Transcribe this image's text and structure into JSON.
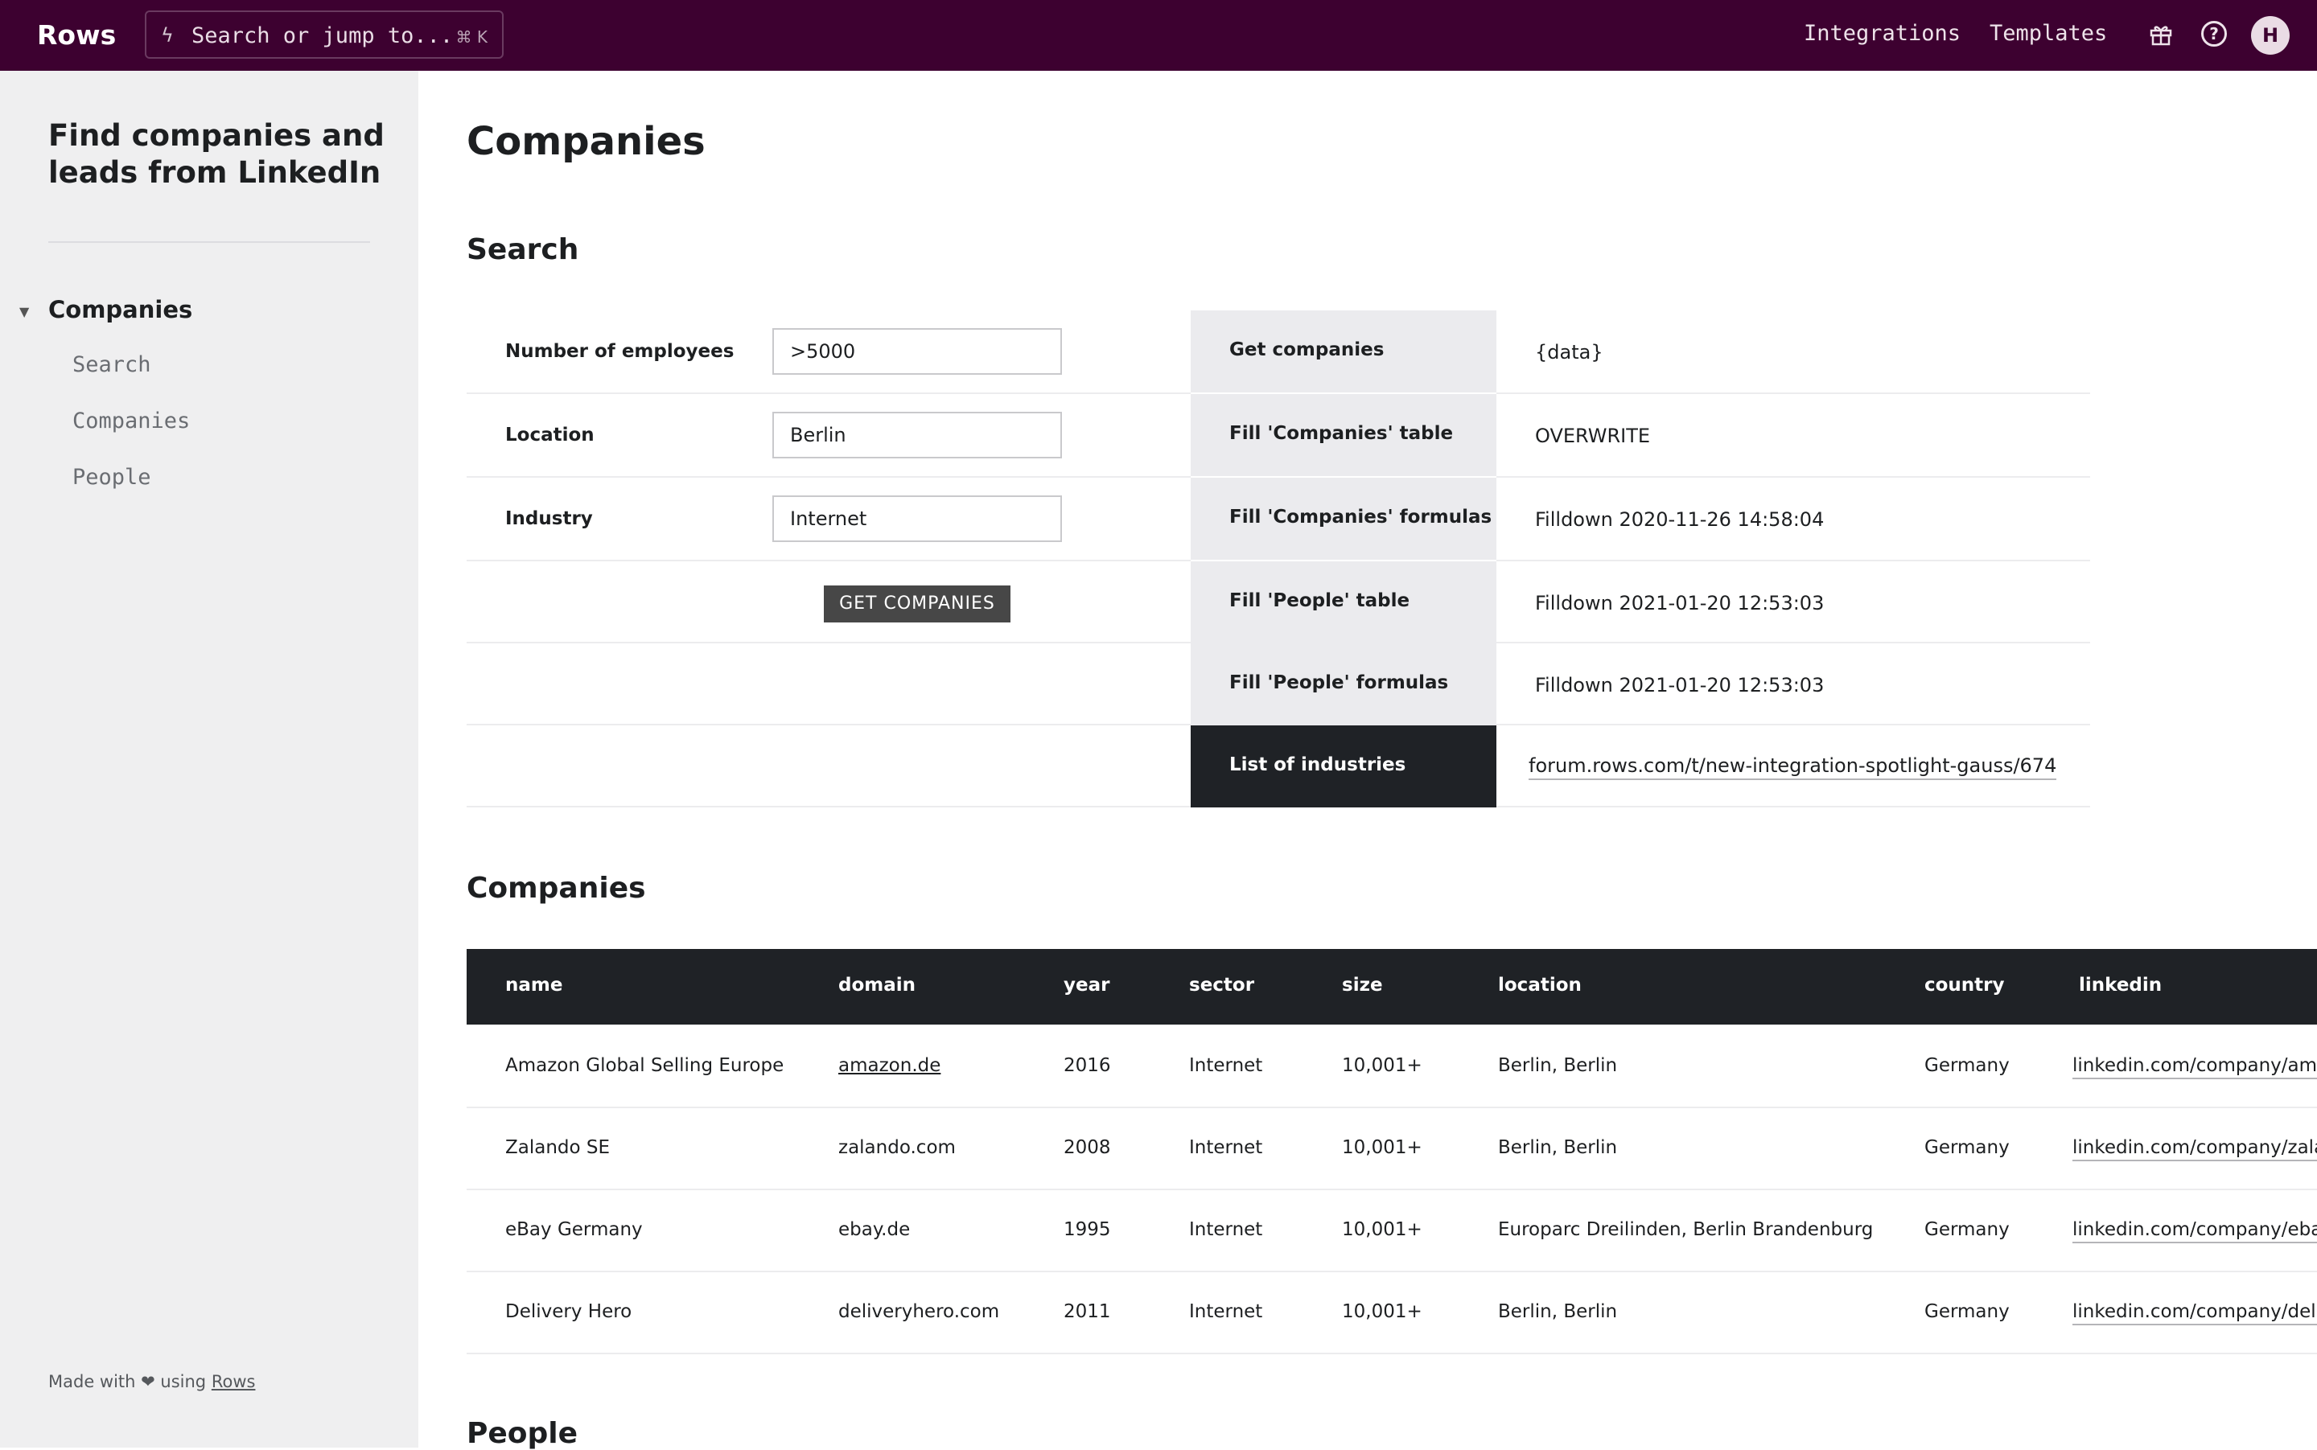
{
  "topbar": {
    "logo": "Rows",
    "search_placeholder": "Search or jump to...",
    "search_shortcut": "⌘ K",
    "nav": [
      "Integrations",
      "Templates"
    ],
    "icons": [
      "gift-icon",
      "help-icon"
    ],
    "avatar_initial": "H",
    "bg_color": "#3d0130"
  },
  "sidebar": {
    "title": "Find companies and leads from LinkedIn",
    "toc": {
      "main": "Companies",
      "items": [
        "Search",
        "Companies",
        "People"
      ]
    },
    "footer": {
      "made_with": "Made with ❤ using",
      "link": "Rows"
    }
  },
  "page": {
    "title": "Companies",
    "search_heading": "Search",
    "companies_heading": "Companies",
    "people_heading": "People"
  },
  "search_form": {
    "fields": [
      {
        "label": "Number of employees",
        "value": ">5000"
      },
      {
        "label": "Location",
        "value": "Berlin"
      },
      {
        "label": "Industry",
        "value": "Internet"
      }
    ],
    "button_label": "GET COMPANIES"
  },
  "actions": [
    {
      "key": "Get companies",
      "value": "{data}"
    },
    {
      "key": "Fill 'Companies' table",
      "value": "OVERWRITE"
    },
    {
      "key": "Fill 'Companies' formulas",
      "value": "Filldown 2020-11-26 14:58:04"
    },
    {
      "key": "Fill 'People' table",
      "value": "Filldown 2021-01-20 12:53:03"
    },
    {
      "key": "Fill 'People' formulas",
      "value": "Filldown 2021-01-20 12:53:03"
    },
    {
      "key": "List of industries",
      "value": "forum.rows.com/t/new-integration-spotlight-gauss/674"
    }
  ],
  "companies_table": {
    "columns": [
      "name",
      "domain",
      "year",
      "sector",
      "size",
      "location",
      "country",
      "linkedin"
    ],
    "rows": [
      [
        "Amazon Global Selling Europe",
        "amazon.de",
        "2016",
        "Internet",
        "10,001+",
        "Berlin, Berlin",
        "Germany",
        "linkedin.com/company/ama"
      ],
      [
        "Zalando SE",
        "zalando.com",
        "2008",
        "Internet",
        "10,001+",
        "Berlin, Berlin",
        "Germany",
        "linkedin.com/company/zala"
      ],
      [
        "eBay Germany",
        "ebay.de",
        "1995",
        "Internet",
        "10,001+",
        "Europarc Dreilinden, Berlin Brandenburg",
        "Germany",
        "linkedin.com/company/eba"
      ],
      [
        "Delivery Hero",
        "deliveryhero.com",
        "2011",
        "Internet",
        "10,001+",
        "Berlin, Berlin",
        "Germany",
        "linkedin.com/company/deli"
      ]
    ]
  }
}
